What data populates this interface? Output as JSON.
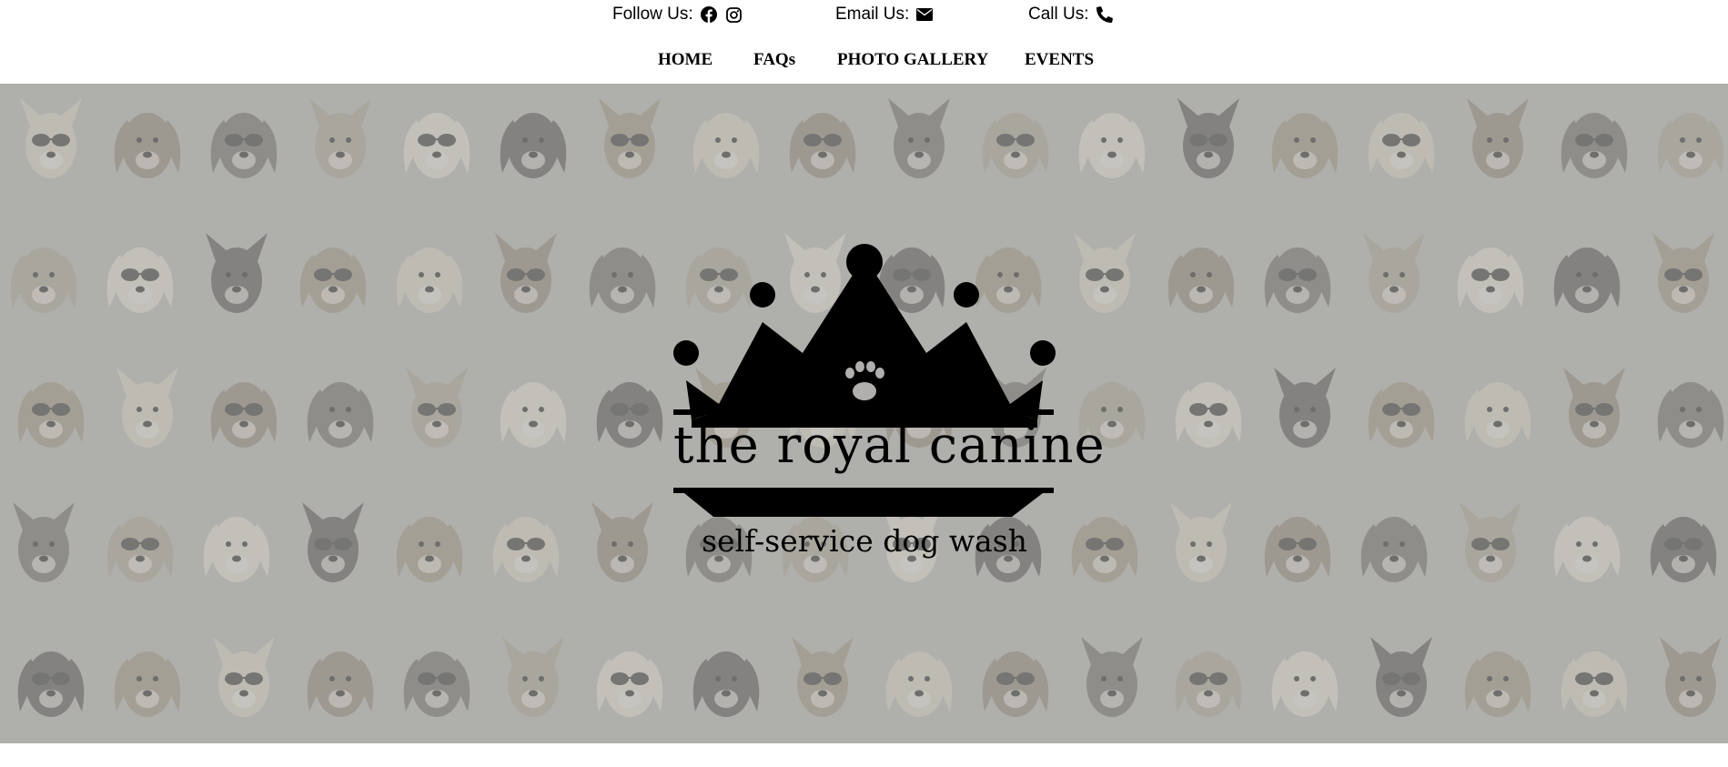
{
  "contact": {
    "follow_label": "Follow Us:",
    "email_label": "Email Us:",
    "call_label": "Call Us:",
    "icons": [
      "facebook-icon",
      "instagram-icon",
      "envelope-icon",
      "phone-icon"
    ]
  },
  "nav": {
    "items": [
      {
        "label": "HOME"
      },
      {
        "label": "FAQs"
      },
      {
        "label": "PHOTO GALLERY"
      },
      {
        "label": "EVENTS"
      }
    ]
  },
  "hero": {
    "background_color": "#b0afad",
    "logo": {
      "title": "the royal canine",
      "subtitle": "self-service dog wash"
    }
  }
}
